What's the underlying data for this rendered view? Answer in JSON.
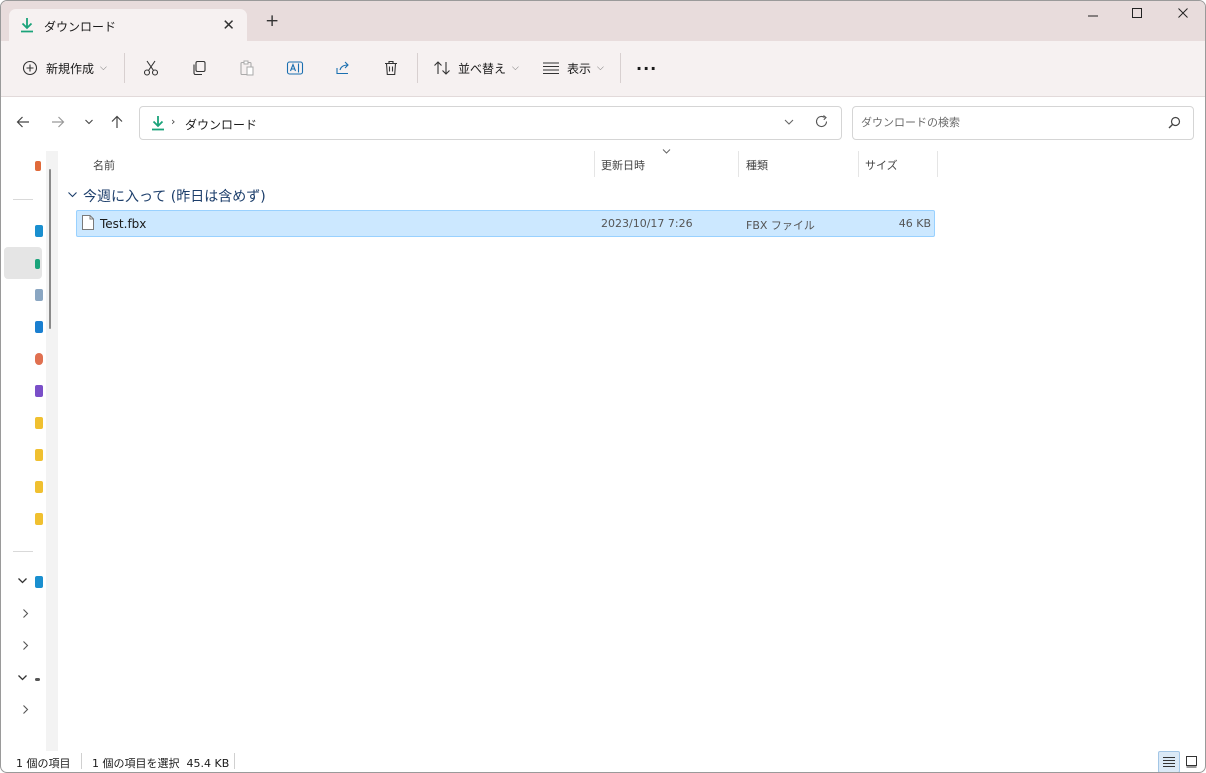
{
  "tab": {
    "title": "ダウンロード",
    "close": "✕"
  },
  "new_tab": "+",
  "window": {
    "minimize": "—",
    "maximize": "☐",
    "close": "✕"
  },
  "toolbar": {
    "new_label": "新規作成",
    "sort_label": "並べ替え",
    "view_label": "表示",
    "more": "···"
  },
  "address": {
    "crumb": "ダウンロード",
    "separator": "›"
  },
  "search": {
    "placeholder": "ダウンロードの検索"
  },
  "columns": {
    "name": "名前",
    "date": "更新日時",
    "type": "種類",
    "size": "サイズ"
  },
  "group": {
    "label": "今週に入って (昨日は含めず)"
  },
  "files": [
    {
      "name": "Test.fbx",
      "date": "2023/10/17 7:26",
      "type": "FBX ファイル",
      "size": "46 KB"
    }
  ],
  "status": {
    "count": "1 個の項目",
    "selection": "1 個の項目を選択  45.4 KB"
  },
  "colors": {
    "accent_download": "#1aa37a",
    "selection_bg": "#cce8ff",
    "group_text": "#1c3e6b",
    "titlebar_bg": "#e8dcdc"
  }
}
